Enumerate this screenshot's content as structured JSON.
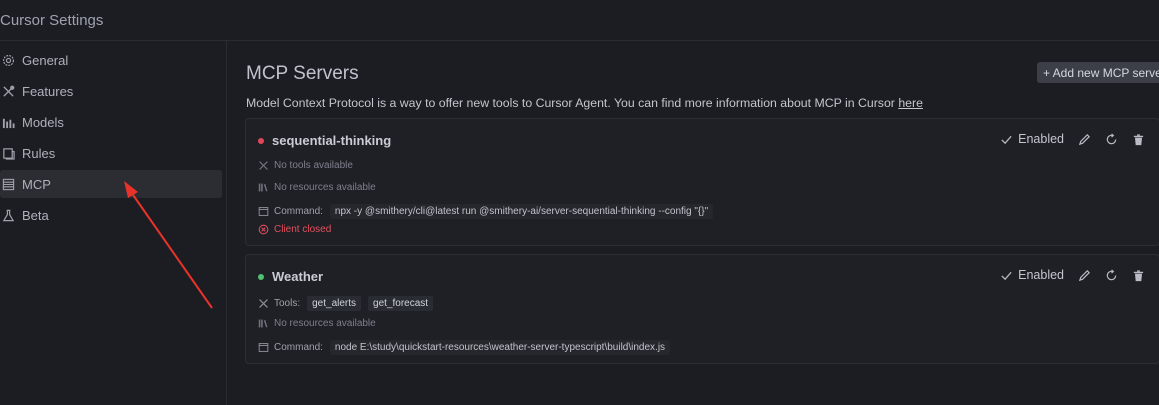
{
  "window": {
    "title": "Cursor Settings"
  },
  "sidebar": {
    "items": [
      {
        "label": "General",
        "icon": "gear-icon",
        "active": false
      },
      {
        "label": "Features",
        "icon": "tools-icon",
        "active": false
      },
      {
        "label": "Models",
        "icon": "bar-chart-icon",
        "active": false
      },
      {
        "label": "Rules",
        "icon": "document-icon",
        "active": false
      },
      {
        "label": "MCP",
        "icon": "server-icon",
        "active": true
      },
      {
        "label": "Beta",
        "icon": "flask-icon",
        "active": false
      }
    ]
  },
  "main": {
    "title": "MCP Servers",
    "add_button": "+ Add new MCP server",
    "description": "Model Context Protocol is a way to offer new tools to Cursor Agent. You can find more information about MCP in Cursor ",
    "description_link": "here",
    "servers": [
      {
        "name": "sequential-thinking",
        "status_color": "#e0485a",
        "enabled_label": "Enabled",
        "tools_text": "No tools available",
        "resources_text": "No resources available",
        "command_label": "Command:",
        "command": "npx -y @smithery/cli@latest run @smithery-ai/server-sequential-thinking --config \"{}\"",
        "error": "Client closed"
      },
      {
        "name": "Weather",
        "status_color": "#4fc26f",
        "enabled_label": "Enabled",
        "tools_label": "Tools:",
        "tools": [
          "get_alerts",
          "get_forecast"
        ],
        "resources_text": "No resources available",
        "command_label": "Command:",
        "command": "node E:\\study\\quickstart-resources\\weather-server-typescript\\build\\index.js"
      }
    ]
  },
  "colors": {
    "background": "#1c1d22",
    "card": "#1f2026",
    "active_nav": "#2b2d33",
    "error": "#e24f5c",
    "ok": "#4fc26f",
    "annotation_arrow": "#e8332a"
  }
}
